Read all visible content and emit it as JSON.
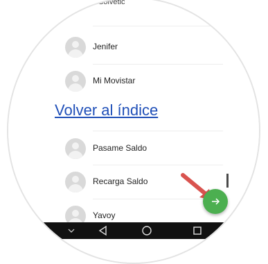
{
  "contacts_header_partial": "Solvetic",
  "contacts": [
    {
      "name": "Jenifer"
    },
    {
      "name": "Mi Movistar"
    },
    {
      "name": "Pasame Saldo"
    },
    {
      "name": "Recarga Saldo"
    },
    {
      "name": "Yavoy"
    }
  ],
  "index_link_label": "Volver al índice",
  "colors": {
    "fab": "#4caf50",
    "annotation_arrow": "#d9534f",
    "link": "#1f4fb8",
    "nav_bar": "#111111"
  },
  "icons": {
    "fab": "arrow-right-icon",
    "nav": [
      "chevron-down-icon",
      "back-triangle-icon",
      "home-circle-icon",
      "recents-square-icon"
    ],
    "annotation": "red-pointer-arrow-icon"
  }
}
